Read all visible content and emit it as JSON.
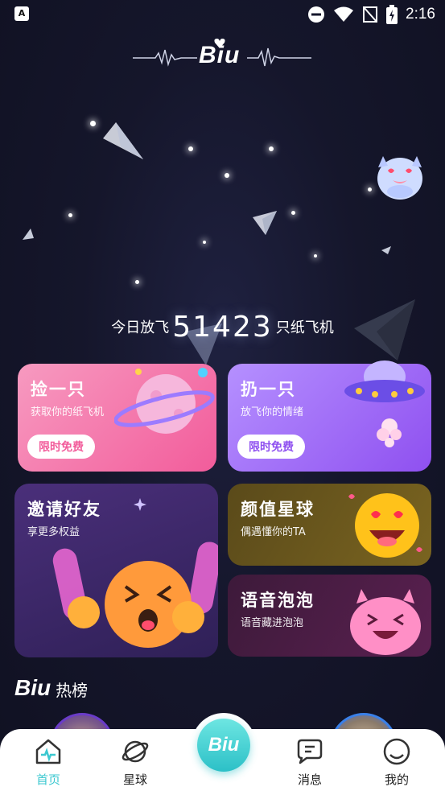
{
  "status_bar": {
    "time": "2:16"
  },
  "header": {
    "logo_text": "Biu"
  },
  "counter": {
    "prefix": "今日放飞",
    "value": "51423",
    "suffix": "只纸飞机"
  },
  "cards": {
    "pick": {
      "title": "捡一只",
      "subtitle": "获取你的纸飞机",
      "button": "限时免费"
    },
    "throw": {
      "title": "扔一只",
      "subtitle": "放飞你的情绪",
      "button": "限时免费"
    },
    "invite": {
      "title": "邀请好友",
      "subtitle": "享更多权益"
    },
    "looks": {
      "title": "颜值星球",
      "subtitle": "偶遇懂你的TA"
    },
    "voice": {
      "title": "语音泡泡",
      "subtitle": "语音藏进泡泡"
    }
  },
  "ranking": {
    "logo_text": "Biu",
    "title": "热榜"
  },
  "tabbar": {
    "home": "首页",
    "planet": "星球",
    "center": "Biu",
    "messages": "消息",
    "mine": "我的"
  },
  "colors": {
    "accent": "#3cc8d0",
    "pick_card": "#f25c9b",
    "throw_card": "#9b5cf2"
  }
}
